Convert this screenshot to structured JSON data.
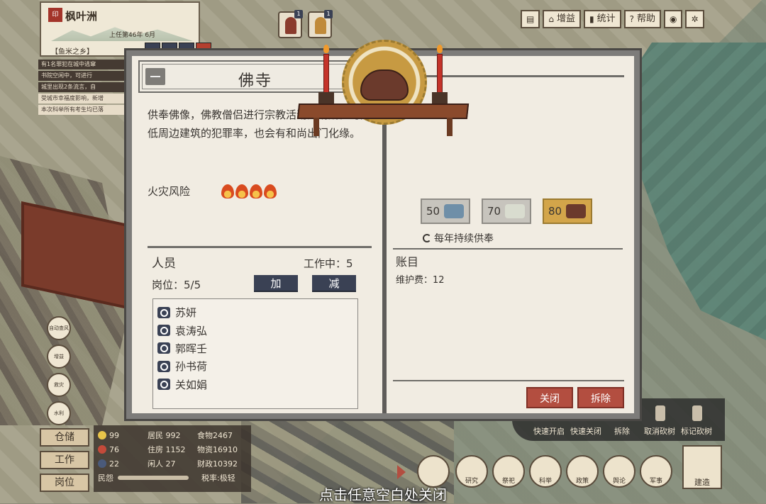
{
  "city": {
    "seal": "印",
    "name": "枫叶洲",
    "tenure": "上任第46年 6月",
    "village": "【鱼米之乡】"
  },
  "notices": [
    "有1名罪犯在城中逃窜",
    "书院空闲中，可进行",
    "城里出现2条流言，自",
    "受城市幸福度影响，新增",
    "本次科举所有考生均已落"
  ],
  "avatars": [
    {
      "badge": "1"
    },
    {
      "badge": "1"
    }
  ],
  "toolbar": {
    "boost": "增益",
    "stats": "统计",
    "help": "帮助"
  },
  "building": {
    "title": "佛寺",
    "description": "供奉佛像，佛教僧侣进行宗教活动的场所。可降低周边建筑的犯罪率，也会有和尚出门化缘。",
    "fire_risk_label": "火灾风险",
    "fire_risk_level": 4
  },
  "staff": {
    "heading": "人员",
    "working": "工作中：5",
    "posts": "岗位：5/5",
    "add_label": "加",
    "remove_label": "减",
    "members": [
      "苏妍",
      "袁涛弘",
      "郭晖壬",
      "孙书荷",
      "关如娟"
    ]
  },
  "ledger": {
    "title": "账目",
    "title2": "账目",
    "resources": [
      {
        "value": "50",
        "icon": "cloth-icon",
        "color": "#6f8fa8"
      },
      {
        "value": "70",
        "icon": "porcelain-icon",
        "color": "#d9dccf"
      },
      {
        "value": "80",
        "icon": "censer-icon",
        "color": "#6b3a2c"
      }
    ],
    "annual": "每年持续供奉",
    "upkeep": "维护费：12"
  },
  "actions": {
    "close": "关闭",
    "demolish": "拆除"
  },
  "side_buttons": [
    "自动查风",
    "增益",
    "救灾",
    "水利"
  ],
  "side_tabs": {
    "storage": "仓储",
    "work": "工作",
    "post": "岗位"
  },
  "stats": {
    "happy": "99",
    "heart": "76",
    "hat": "22",
    "residents": "居民 992",
    "housing": "住房 1152",
    "idle": "闲人 27",
    "food": "食物2467",
    "goods": "物资16910",
    "treasury": "财政10392",
    "mood_label": "民怨",
    "tax": "税率:极轻"
  },
  "quick_menu": {
    "open_fast": "快速开启",
    "close_fast": "快速关闭",
    "demolish": "拆除",
    "cancel_cut": "取消砍树",
    "mark_cut": "标记砍树"
  },
  "bottom_menu": {
    "items": [
      "",
      "研究",
      "祭祀",
      "科举",
      "政策",
      "舆论",
      "军事"
    ],
    "build": "建造"
  },
  "hint": "点击任意空白处关闭"
}
